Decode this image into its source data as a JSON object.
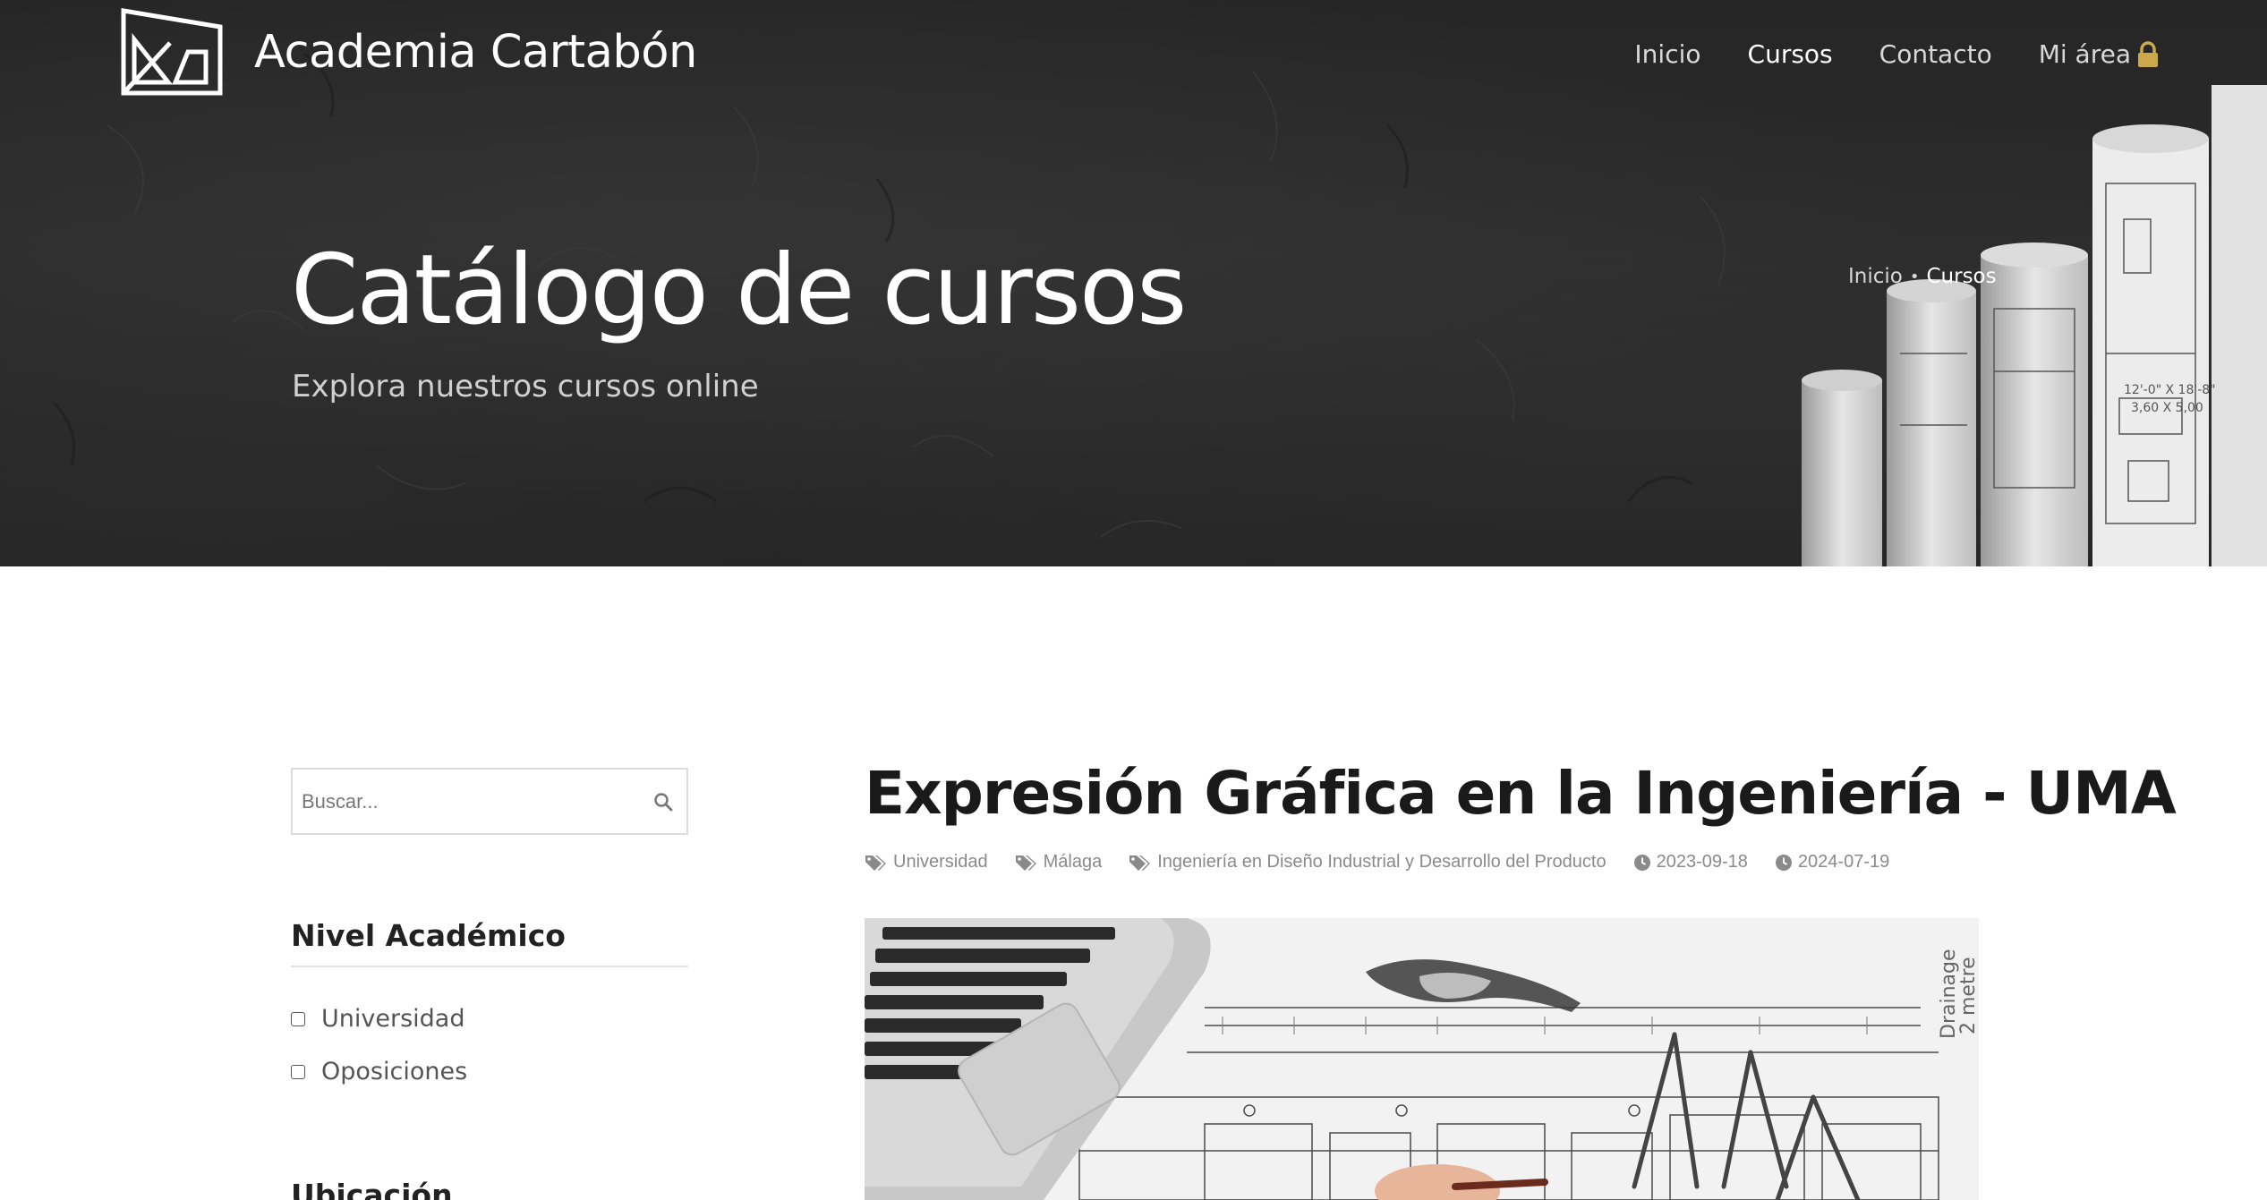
{
  "header": {
    "brand": "Academia Cartabón",
    "nav": [
      {
        "label": "Inicio",
        "active": false
      },
      {
        "label": "Cursos",
        "active": true
      },
      {
        "label": "Contacto",
        "active": false
      },
      {
        "label": "Mi área",
        "active": false,
        "icon": "lock-icon"
      }
    ]
  },
  "hero": {
    "title": "Catálogo de cursos",
    "subtitle": "Explora nuestros cursos online",
    "breadcrumb": {
      "home": "Inicio",
      "separator": "•",
      "current": "Cursos"
    }
  },
  "sidebar": {
    "search": {
      "placeholder": "Buscar...",
      "value": ""
    },
    "filters": [
      {
        "title": "Nivel Académico",
        "options": [
          "Universidad",
          "Oposiciones"
        ]
      },
      {
        "title": "Ubicación",
        "options": []
      }
    ]
  },
  "course": {
    "title": "Expresión Gráfica en la Ingeniería - UMA",
    "tags": [
      "Universidad",
      "Málaga",
      "Ingeniería en Diseño Industrial y Desarrollo del Producto"
    ],
    "dates": [
      "2023-09-18",
      "2024-07-19"
    ]
  },
  "colors": {
    "hero_background": "#272727",
    "lock_icon": "#c9a94a",
    "meta_text": "#8a8a8a"
  }
}
